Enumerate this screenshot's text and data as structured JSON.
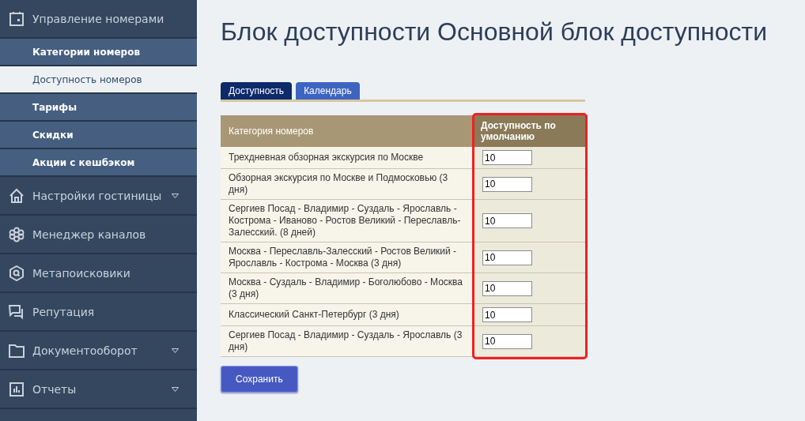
{
  "sidebar": {
    "items": [
      {
        "label": "Управление номерами",
        "kind": "calendar",
        "has_caret": false,
        "children": [
          {
            "label": "Категории номеров",
            "selected": false
          },
          {
            "label": "Доступность номеров",
            "selected": true
          },
          {
            "label": "Тарифы",
            "selected": false
          },
          {
            "label": "Скидки",
            "selected": false
          },
          {
            "label": "Акции с кешбэком",
            "selected": false
          }
        ]
      },
      {
        "label": "Настройки гостиницы",
        "kind": "house",
        "has_caret": true
      },
      {
        "label": "Менеджер каналов",
        "kind": "flower",
        "has_caret": false
      },
      {
        "label": "Метапоисковики",
        "kind": "hex-search",
        "has_caret": false
      },
      {
        "label": "Репутация",
        "kind": "chat",
        "has_caret": false
      },
      {
        "label": "Документооборот",
        "kind": "folder",
        "has_caret": true
      },
      {
        "label": "Отчеты",
        "kind": "chart",
        "has_caret": true
      }
    ]
  },
  "page_title": "Блок доступности Основной блок доступности",
  "tabs": [
    {
      "label": "Доступность",
      "selected": true
    },
    {
      "label": "Календарь",
      "selected": false
    }
  ],
  "table": {
    "columns": [
      {
        "label": "Категория номеров",
        "highlighted": false
      },
      {
        "label": "Доступность по умолчанию",
        "highlighted": true
      }
    ],
    "rows": [
      {
        "category": "Трехдневная обзорная экскурсия по Москве",
        "value": "10"
      },
      {
        "category": "Обзорная экскурсия по Москве и Подмосковью (3 дня)",
        "value": "10"
      },
      {
        "category": "Сергиев Посад - Владимир - Суздаль - Ярославль - Кострома - Иваново - Ростов Великий - Переславль-Залесский. (8 дней)",
        "value": "10"
      },
      {
        "category": "Москва - Переславль-Залесский - Ростов Великий - Ярославль - Кострома - Москва (3 дня)",
        "value": "10"
      },
      {
        "category": "Москва - Суздаль - Владимир - Боголюбово - Москва (3 дня)",
        "value": "10"
      },
      {
        "category": "Классический Санкт-Петербург (3 дня)",
        "value": "10"
      },
      {
        "category": "Сергиев Посад - Владимир - Суздаль - Ярославль (3 дня)",
        "value": "10"
      }
    ]
  },
  "save_button": "Сохранить"
}
